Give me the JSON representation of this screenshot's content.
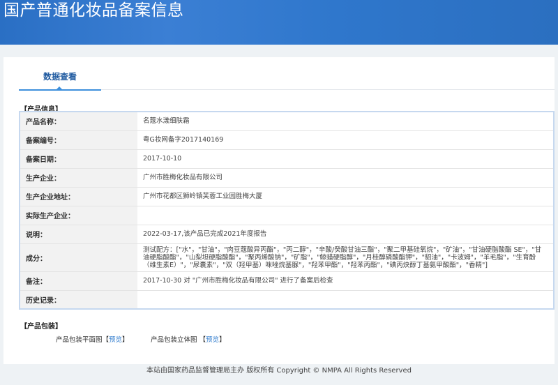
{
  "header": {
    "title": "国产普通化妆品备案信息"
  },
  "tab": {
    "label": "数据查看"
  },
  "product_info": {
    "section_title": "【产品信息】",
    "rows": [
      {
        "label": "产品名称：",
        "value": "名蔻水漾细肤霜"
      },
      {
        "label": "备案编号：",
        "value": "粤G妆网备字2017140169"
      },
      {
        "label": "备案日期：",
        "value": "2017-10-10"
      },
      {
        "label": "生产企业：",
        "value": "广州市胜梅化妆品有限公司"
      },
      {
        "label": "生产企业地址：",
        "value": "广州市花都区狮岭镇芙蓉工业园胜梅大厦"
      },
      {
        "label": "实际生产企业：",
        "value": ""
      },
      {
        "label": "说明：",
        "value": "2022-03-17,该产品已完成2021年度报告"
      },
      {
        "label": "成分：",
        "value": "测试配方：[\"水\"，\"甘油\"，\"肉豆蔻酸异丙酯\"，\"丙二醇\"，\"辛酸/癸酸甘油三酯\"，\"聚二甲基硅氧烷\"，\"矿油\"，\"甘油硬脂酸酯 SE\"，\"甘油硬脂酸酯\"，\"山梨坦硬脂酸酯\"，\"聚丙烯酸钠\"，\"矿脂\"，\"鲸蜡硬脂醇\"，\"月桂醇磷酸酯钾\"，\"貂油\"，\"卡波姆\"，\"羊毛脂\"，\"生育酚（维生素E）\"，\"尿囊素\"，\"双（羟甲基）咪唑烷基脲\"，\"羟苯甲酯\"，\"羟苯丙酯\"，\"碘丙炔醇丁基氨甲酸酯\"，\"香精\"]"
      },
      {
        "label": "备注：",
        "value": "2017-10-30 对 \"广州市胜梅化妆品有限公司\" 进行了备案后检查"
      },
      {
        "label": "历史记录：",
        "value": ""
      }
    ]
  },
  "packaging": {
    "section_title": "【产品包装】",
    "items": [
      {
        "label": "产品包装平面图",
        "link": "预览"
      },
      {
        "label": "产品包装立体图",
        "link": "预览"
      }
    ]
  },
  "footer": {
    "text": "本站由国家药品监督管理局主办 版权所有 Copyright © NMPA All Rights Reserved"
  }
}
